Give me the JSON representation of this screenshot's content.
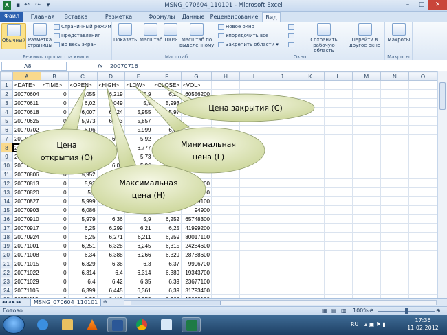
{
  "window": {
    "title": "MSNG_070604_110101 - Microsoft Excel"
  },
  "tabs": [
    "Файл",
    "Главная",
    "Вставка",
    "Разметка страницы",
    "Формулы",
    "Данные",
    "Рецензирование",
    "Вид"
  ],
  "ribbon": {
    "group_views": {
      "label": "Режимы просмотра книги",
      "normal": "Обычный",
      "page_layout_1": "Разметка",
      "page_layout_2": "страницы",
      "page_break": "Страничный режим",
      "custom_views": "Представления",
      "full_screen": "Во весь экран"
    },
    "show": "Показать",
    "group_zoom": {
      "label": "Масштаб",
      "zoom": "Масштаб",
      "zoom100": "100%",
      "zoom_sel_1": "Масштаб по",
      "zoom_sel_2": "выделенному"
    },
    "group_window": {
      "label": "Окно",
      "new_window": "Новое окно",
      "arrange_all": "Упорядочить все",
      "freeze": "Закрепить области",
      "save_ws_1": "Сохранить",
      "save_ws_2": "рабочую область",
      "switch_1": "Перейти в",
      "switch_2": "другое окно"
    },
    "group_macros": {
      "label": "Макросы",
      "macros": "Макросы"
    }
  },
  "formula_bar": {
    "name_box": "A8",
    "fx": "fx",
    "value": "20070716"
  },
  "columns": [
    "A",
    "B",
    "C",
    "D",
    "E",
    "F",
    "G",
    "H",
    "I",
    "J",
    "K",
    "L",
    "M",
    "N",
    "O"
  ],
  "rows": [
    [
      "<DATE>",
      "<TIME>",
      "<OPEN>",
      "<HIGH>",
      "<LOW>",
      "<CLOSE>",
      "<VOL>"
    ],
    [
      "20070604",
      "0",
      "6,055",
      "6,219",
      "5,9",
      "6,21",
      "60556200"
    ],
    [
      "20070611",
      "0",
      "6,02",
      "6,049",
      "5,9",
      "5,993",
      ""
    ],
    [
      "20070618",
      "0",
      "6,007",
      "6,124",
      "5,955",
      "5,97",
      ""
    ],
    [
      "20070625",
      "0",
      "5,973",
      "6,053",
      "5,857",
      "",
      ""
    ],
    [
      "20070702",
      "0",
      "6,06",
      "6,1",
      "5,999",
      "6,03",
      "88900"
    ],
    [
      "20070709",
      "0",
      "",
      "6,06",
      "5,92",
      "",
      ""
    ],
    [
      "20070716",
      "",
      "",
      "",
      "6,777",
      "",
      ""
    ],
    [
      "200707",
      "",
      "",
      "",
      "5,73",
      "",
      ""
    ],
    [
      "200707",
      "",
      "",
      "6,03",
      "5,96",
      "",
      ""
    ],
    [
      "20070806",
      "0",
      "5,952",
      "",
      "",
      "",
      ""
    ],
    [
      "20070813",
      "0",
      "5,93",
      "",
      "",
      "",
      "54200"
    ],
    [
      "20070820",
      "0",
      "5,9",
      "",
      "",
      "",
      "25500"
    ],
    [
      "20070827",
      "0",
      "5,999",
      "",
      "",
      "",
      "49100"
    ],
    [
      "20070903",
      "0",
      "6,086",
      "",
      "",
      "",
      "94900"
    ],
    [
      "20070910",
      "0",
      "5,979",
      "6,36",
      "5,9",
      "6,252",
      "65748300"
    ],
    [
      "20070917",
      "0",
      "6,25",
      "6,299",
      "6,21",
      "6,25",
      "41999200"
    ],
    [
      "20070924",
      "0",
      "6,25",
      "6,271",
      "6,211",
      "6,259",
      "80017100"
    ],
    [
      "20071001",
      "0",
      "6,251",
      "6,328",
      "6,245",
      "6,315",
      "24284600"
    ],
    [
      "20071008",
      "0",
      "6,34",
      "6,388",
      "6,266",
      "6,329",
      "28788600"
    ],
    [
      "20071015",
      "0",
      "6,329",
      "6,38",
      "6,3",
      "6,37",
      "9996700"
    ],
    [
      "20071022",
      "0",
      "6,314",
      "6,4",
      "6,314",
      "6,389",
      "19343700"
    ],
    [
      "20071029",
      "0",
      "6,4",
      "6,42",
      "6,35",
      "6,39",
      "23677100"
    ],
    [
      "20071105",
      "0",
      "6,399",
      "6,445",
      "6,361",
      "6,39",
      "31793400"
    ],
    [
      "20071112",
      "0",
      "6,39",
      "6,418",
      "6,353",
      "6,366",
      "12072100"
    ]
  ],
  "callouts": {
    "close": "Цена закрытия (С)",
    "open_1": "Цена",
    "open_2": "открытия (О)",
    "low_1": "Минимальная",
    "low_2": "цена (L)",
    "high_1": "Максимальная",
    "high_2": "цена (Н)"
  },
  "sheet_tab": "MSNG_070604_110101",
  "status": {
    "ready": "Готово",
    "zoom": "100%"
  },
  "taskbar": {
    "lang": "RU",
    "time": "17:36",
    "date": "11.02.2012"
  },
  "colors": {
    "file_tab": "#2a5fb0",
    "callout_fill": "#f2f5dc",
    "callout_fill_edge": "#cdd79c",
    "taskbar": "#1d3f63"
  }
}
